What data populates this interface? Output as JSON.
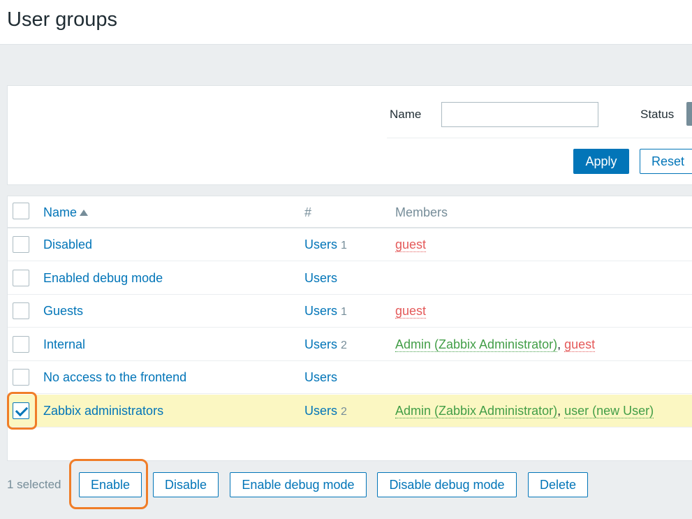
{
  "page": {
    "title": "User groups"
  },
  "filter": {
    "name_label": "Name",
    "name_value": "",
    "status_label": "Status",
    "apply_label": "Apply",
    "reset_label": "Reset"
  },
  "table": {
    "headers": {
      "name": "Name",
      "users": "#",
      "members": "Members"
    },
    "rows": [
      {
        "name": "Disabled",
        "users_label": "Users",
        "users_count": "1",
        "members": [
          {
            "text": "guest",
            "color": "red"
          }
        ],
        "checked": false
      },
      {
        "name": "Enabled debug mode",
        "users_label": "Users",
        "users_count": "",
        "members": [],
        "checked": false
      },
      {
        "name": "Guests",
        "users_label": "Users",
        "users_count": "1",
        "members": [
          {
            "text": "guest",
            "color": "red"
          }
        ],
        "checked": false
      },
      {
        "name": "Internal",
        "users_label": "Users",
        "users_count": "2",
        "members": [
          {
            "text": "Admin (Zabbix Administrator)",
            "color": "green"
          },
          {
            "text": "guest",
            "color": "red"
          }
        ],
        "checked": false
      },
      {
        "name": "No access to the frontend",
        "users_label": "Users",
        "users_count": "",
        "members": [],
        "checked": false
      },
      {
        "name": "Zabbix administrators",
        "users_label": "Users",
        "users_count": "2",
        "members": [
          {
            "text": "Admin (Zabbix Administrator)",
            "color": "green"
          },
          {
            "text": "user (new User)",
            "color": "green"
          }
        ],
        "checked": true
      }
    ]
  },
  "footer": {
    "selected_text": "1 selected",
    "actions": {
      "enable": "Enable",
      "disable": "Disable",
      "enable_debug": "Enable debug mode",
      "disable_debug": "Disable debug mode",
      "delete": "Delete"
    }
  },
  "colors": {
    "accent": "#0275b8",
    "highlight": "#f07d28",
    "selected_row": "#fbf7c2",
    "member_red": "#e45959",
    "member_green": "#429e47"
  }
}
